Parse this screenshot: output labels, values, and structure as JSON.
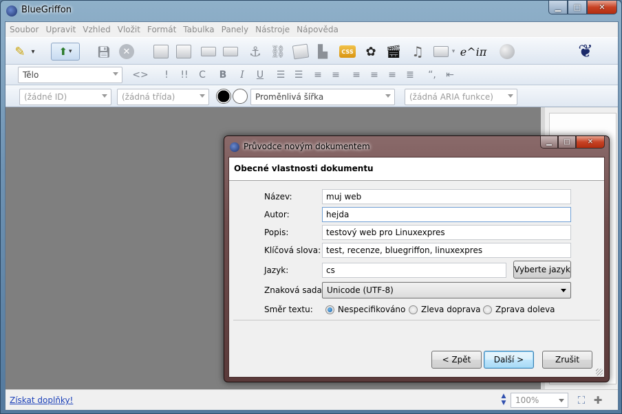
{
  "window": {
    "title": "BlueGriffon"
  },
  "menubar": {
    "items": [
      "Soubor",
      "Upravit",
      "Vzhled",
      "Vložit",
      "Formát",
      "Tabulka",
      "Panely",
      "Nástroje",
      "Nápověda"
    ]
  },
  "toolbar_format": {
    "block_format": "Tělo",
    "code_label": "<>",
    "emphasis_label": "!",
    "strong_label": "!!",
    "code_c_label": "C",
    "bold_label": "B",
    "italic_label": "I",
    "underline_label": "U",
    "quote_label": "“,"
  },
  "toolbar_main": {
    "math_label": "e^iπ"
  },
  "toolbar_attrs": {
    "id_placeholder": "(žádné ID)",
    "class_placeholder": "(žádná třída)",
    "width_value": "Proměnlivá šířka",
    "aria_placeholder": "(žádná ARIA funkce)"
  },
  "statusbar": {
    "addons_link": "Získat doplňky!",
    "zoom": "100%"
  },
  "dialog": {
    "title": "Průvodce novým dokumentem",
    "header": "Obecné vlastnosti dokumentu",
    "fields": {
      "name_label": "Název:",
      "name_value": "muj web",
      "author_label": "Autor:",
      "author_value": "hejda",
      "description_label": "Popis:",
      "description_value": "testový web pro Linuxexpres",
      "keywords_label": "Klíčová slova:",
      "keywords_value": "test, recenze, bluegriffon, linuxexpres",
      "language_label": "Jazyk:",
      "language_value": "cs",
      "choose_language_button": "Vyberte jazyk",
      "charset_label": "Znaková sada:",
      "charset_value": "Unicode (UTF-8)",
      "direction_label": "Směr textu:",
      "direction_options": [
        "Nespecifikováno",
        "Zleva doprava",
        "Zprava doleva"
      ],
      "direction_selected": "Nespecifikováno"
    },
    "buttons": {
      "back": "< Zpět",
      "next": "Další >",
      "cancel": "Zrušit"
    }
  },
  "colors": {
    "link": "#1a3fb8",
    "canvas": "#7f7f7f",
    "default_button": "#3c7fb1"
  }
}
